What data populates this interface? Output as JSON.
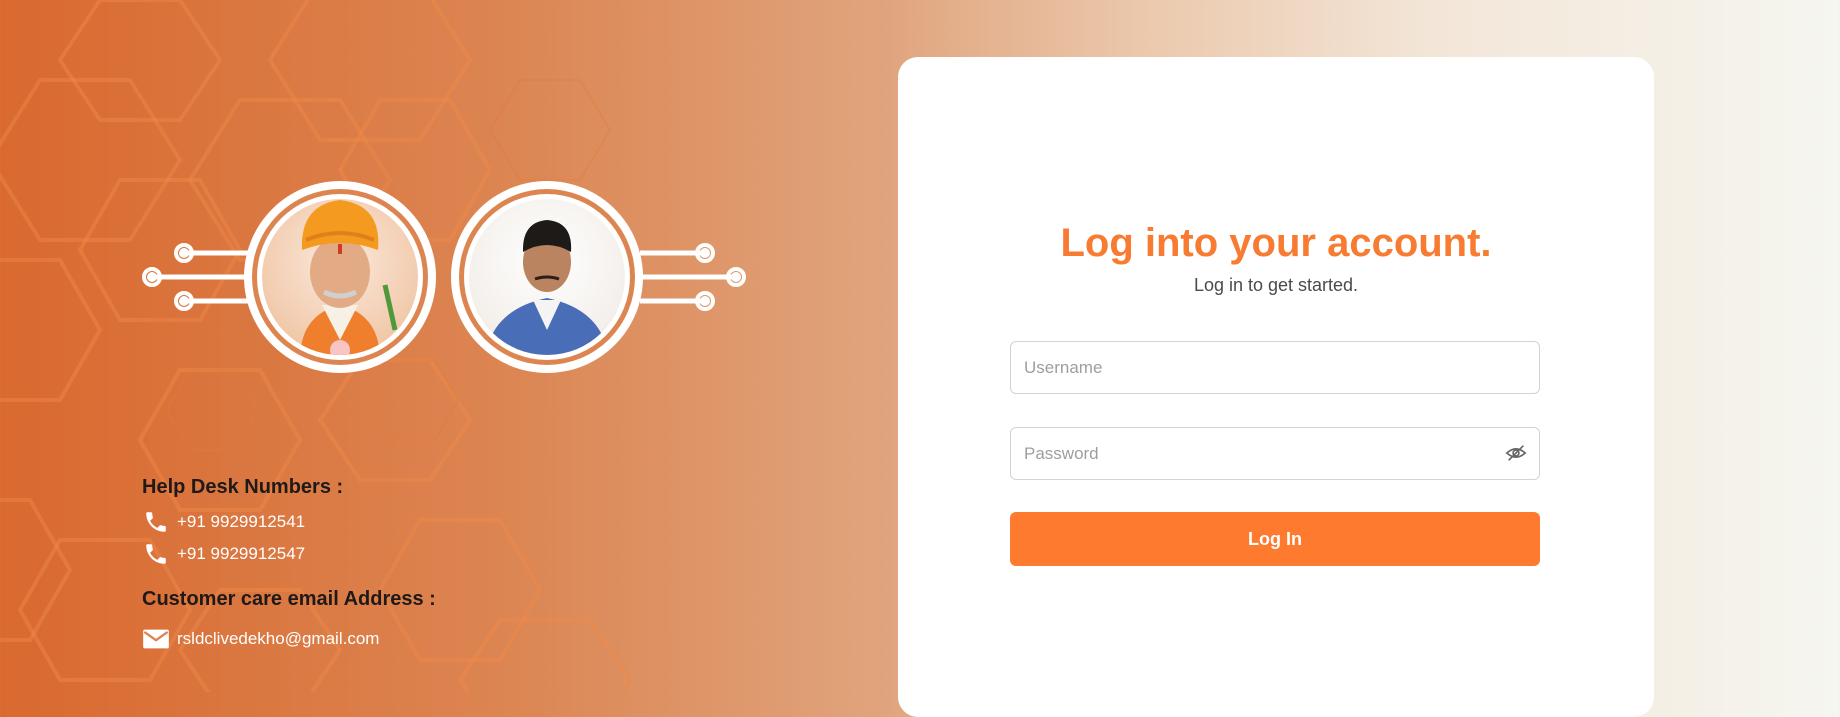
{
  "colors": {
    "accent": "#f77b30",
    "button": "#fe7a2f",
    "panel": "#ffffff",
    "background_left": "#d9692f",
    "background_right": "#f5f6f0"
  },
  "portraits": [
    {
      "icon": "portrait-man-saffron-turban"
    },
    {
      "icon": "portrait-man-blue-vest"
    }
  ],
  "contact": {
    "helpdesk_heading": "Help Desk Numbers :",
    "phones": [
      "+91 9929912541",
      "+91 9929912547"
    ],
    "email_heading": "Customer care email Address :",
    "email": "rsldclivedekho@gmail.com",
    "phone_icon": "phone-icon",
    "email_icon": "mail-icon"
  },
  "login": {
    "title": "Log into your account.",
    "subtitle": "Log in to get started.",
    "username_placeholder": "Username",
    "username_value": "",
    "password_placeholder": "Password",
    "password_value": "",
    "password_toggle_icon": "eye-slash-icon",
    "button_label": "Log In"
  }
}
